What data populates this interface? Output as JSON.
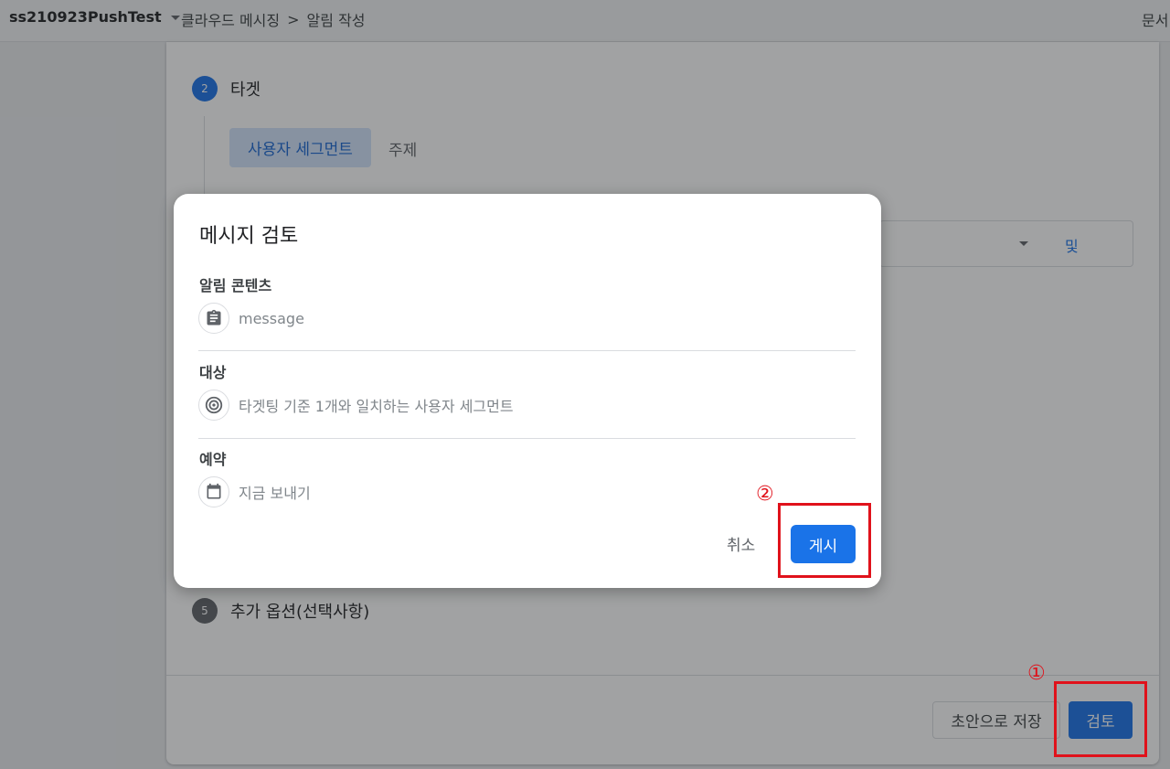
{
  "topbar": {
    "project": "ss210923PushTest",
    "breadcrumb": [
      "클라우드 메시징",
      "알림 작성"
    ],
    "separator": ">",
    "docs": "문서"
  },
  "steps": [
    {
      "number": "2",
      "label": "타겟"
    },
    {
      "number": "5",
      "label": "추가 옵션(선택사항)"
    }
  ],
  "target": {
    "segment_tab": "사용자 세그먼트",
    "topic_tab": "주제",
    "and_label": "및"
  },
  "footer": {
    "draft_button": "초안으로 저장",
    "review_button": "검토"
  },
  "dialog": {
    "title": "메시지 검토",
    "sections": [
      {
        "label": "알림 콘텐츠",
        "icon": "clipboard-icon",
        "value": "message"
      },
      {
        "label": "대상",
        "icon": "target-icon",
        "value": "타겟팅 기준 1개와 일치하는 사용자 세그먼트"
      },
      {
        "label": "예약",
        "icon": "calendar-icon",
        "value": "지금 보내기"
      }
    ],
    "cancel_button": "취소",
    "publish_button": "게시"
  },
  "annotations": {
    "first": "①",
    "second": "②",
    "color": "#e0121b"
  }
}
